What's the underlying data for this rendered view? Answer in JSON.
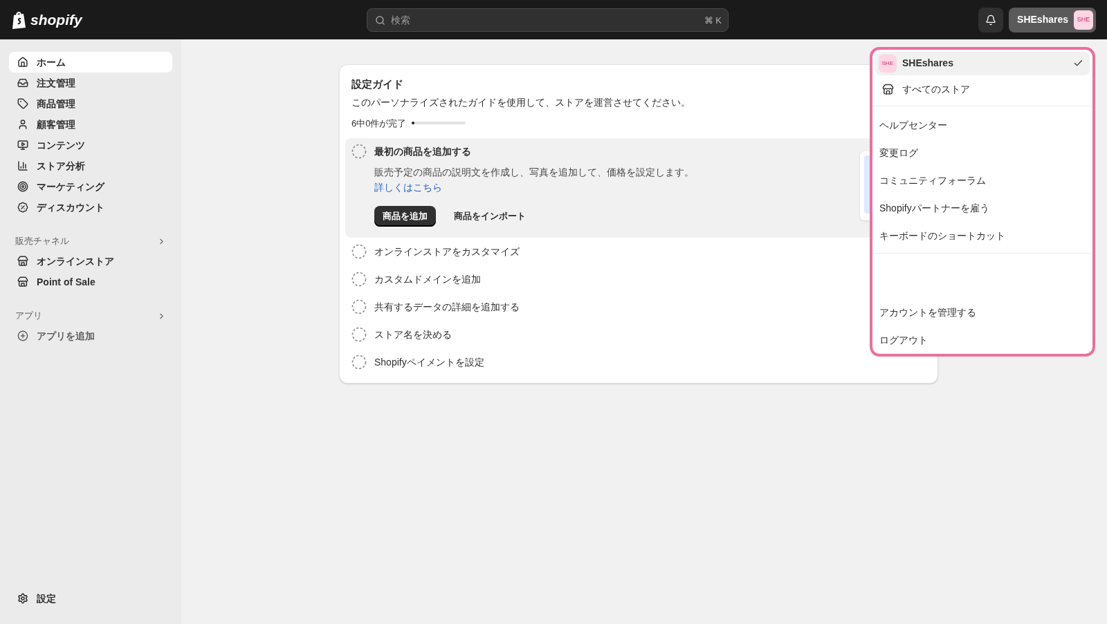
{
  "topbar": {
    "logo": "shopify",
    "search": {
      "placeholder": "検索",
      "shortcut": "⌘ K"
    },
    "store_button": {
      "label": "SHEshares",
      "avatar": "SHE"
    }
  },
  "sidebar": {
    "items": [
      {
        "label": "ホーム",
        "selected": true
      },
      {
        "label": "注文管理",
        "selected": false
      },
      {
        "label": "商品管理",
        "selected": false
      },
      {
        "label": "顧客管理",
        "selected": false
      },
      {
        "label": "コンテンツ",
        "selected": false
      },
      {
        "label": "ストア分析",
        "selected": false
      },
      {
        "label": "マーケティング",
        "selected": false
      },
      {
        "label": "ディスカウント",
        "selected": false
      }
    ],
    "sections": [
      {
        "title": "販売チャネル",
        "items": [
          {
            "label": "オンラインストア",
            "selected": false
          },
          {
            "label": "Point of Sale",
            "selected": false
          }
        ]
      },
      {
        "title": "アプリ",
        "items": [
          {
            "label": "アプリを追加",
            "selected": false
          }
        ]
      }
    ],
    "settings": "設定"
  },
  "setup_guide": {
    "title": "設定ガイド",
    "description": "このパーソナライズされたガイドを使用して、ストアを運営させてください。",
    "progress_text": "6中0件が完了",
    "level": 0,
    "tasks": [
      {
        "title": "最初の商品を追加する",
        "expanded": true,
        "description": "販売予定の商品の説明文を作成し、写真を追加して、価格を設定します。",
        "link": "詳しくはこちら",
        "buttons": [
          "商品を追加",
          "商品をインポート"
        ]
      },
      {
        "title": "オンラインストアをカスタマイズ",
        "expanded": false
      },
      {
        "title": "カスタムドメインを追加",
        "expanded": false
      },
      {
        "title": "共有するデータの詳細を追加する",
        "expanded": false
      },
      {
        "title": "ストア名を決める",
        "expanded": false
      },
      {
        "title": "Shopifyペイメントを設定",
        "expanded": false
      }
    ]
  },
  "store_menu": {
    "store": {
      "name": "SHEshares",
      "avatar": "SHE",
      "selected": true
    },
    "all_stores": "すべてのストア",
    "links": [
      "ヘルプセンター",
      "変更ログ",
      "コミュニティフォーラム",
      "Shopifyパートナーを雇う",
      "キーボードのショートカット"
    ],
    "account_links": [
      "アカウントを管理する",
      "ログアウト"
    ]
  }
}
